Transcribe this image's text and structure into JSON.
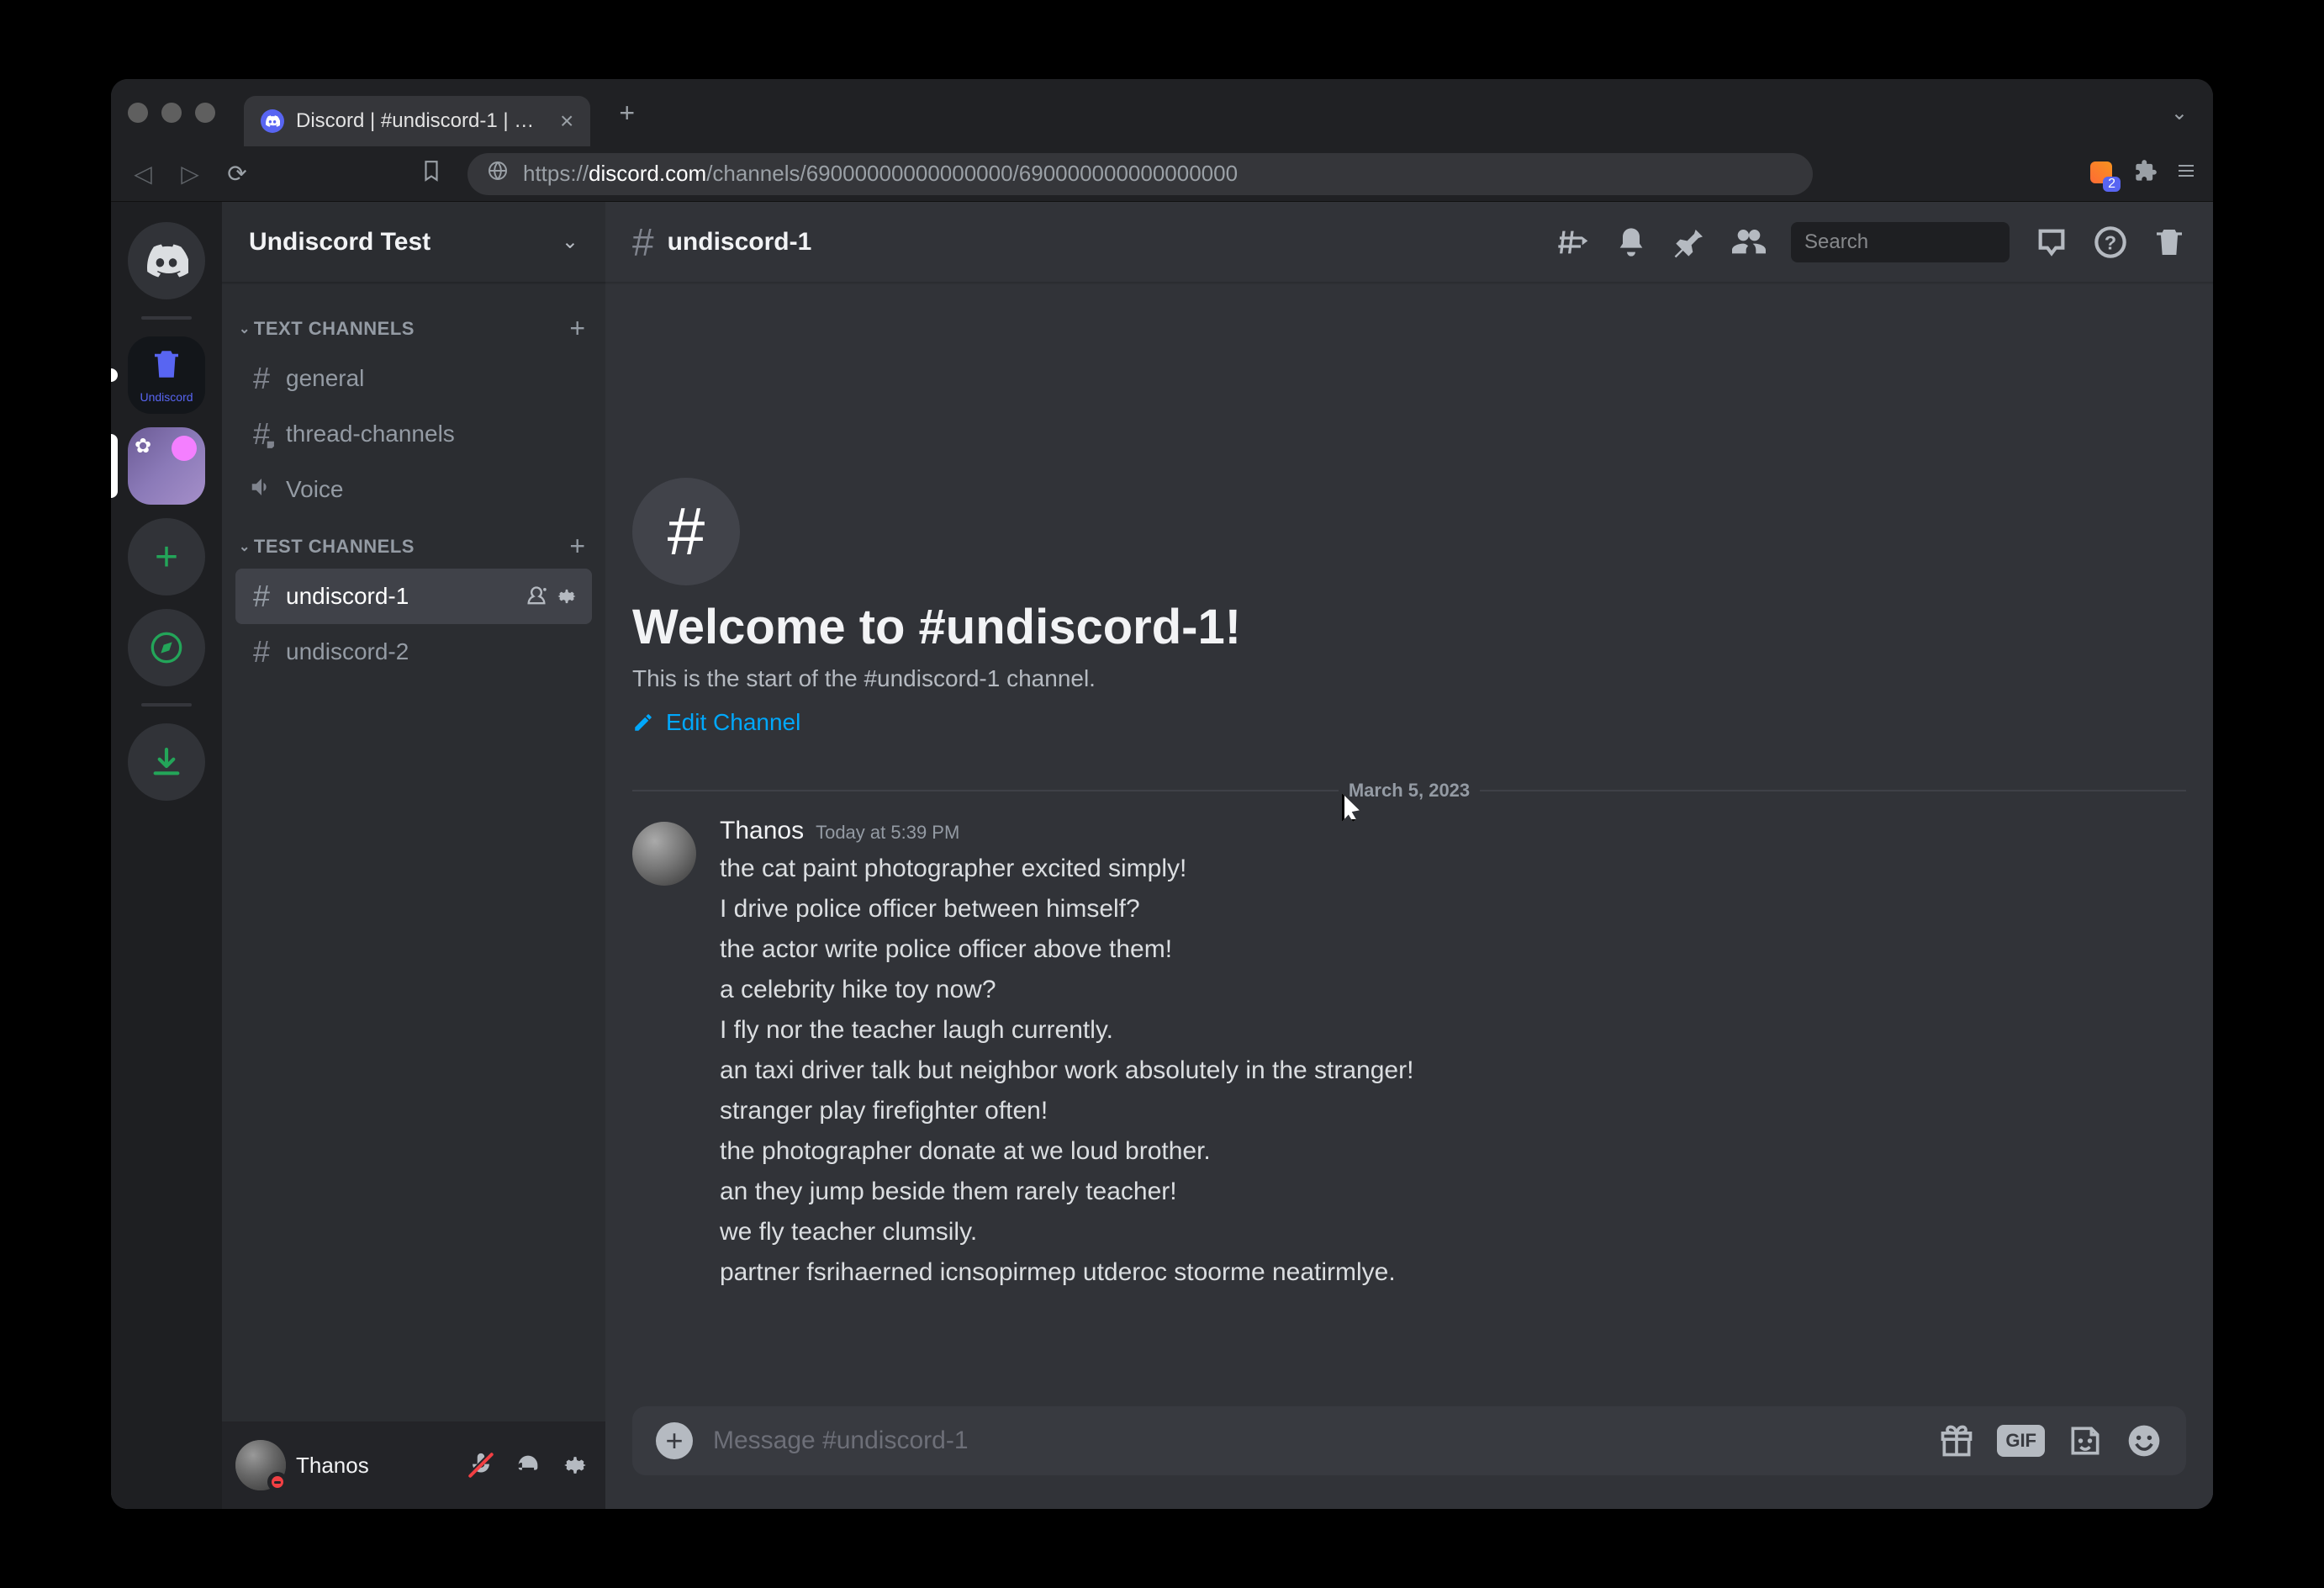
{
  "browser": {
    "tab_title": "Discord | #undiscord-1 | Undisc",
    "url_prefix": "https://",
    "url_host": "discord.com",
    "url_path": "/channels/69000000000000000/690000000000000000",
    "ext_badge": "2"
  },
  "server": {
    "name": "Undiscord Test"
  },
  "categories": [
    {
      "label": "TEXT CHANNELS",
      "channels": [
        {
          "name": "general",
          "type": "text",
          "active": false
        },
        {
          "name": "thread-channels",
          "type": "thread",
          "active": false
        },
        {
          "name": "Voice",
          "type": "voice",
          "active": false
        }
      ]
    },
    {
      "label": "TEST CHANNELS",
      "channels": [
        {
          "name": "undiscord-1",
          "type": "text",
          "active": true
        },
        {
          "name": "undiscord-2",
          "type": "text",
          "active": false
        }
      ]
    }
  ],
  "user": {
    "name": "Thanos"
  },
  "chat": {
    "channel_name": "undiscord-1",
    "search_placeholder": "Search",
    "welcome_title": "Welcome to #undiscord-1!",
    "welcome_sub": "This is the start of the #undiscord-1 channel.",
    "edit_channel": "Edit Channel",
    "date_divider": "March 5, 2023",
    "composer_placeholder": "Message #undiscord-1",
    "gif_label": "GIF"
  },
  "message": {
    "author": "Thanos",
    "timestamp": "Today at 5:39 PM",
    "lines": [
      "the cat paint photographer excited simply!",
      "I drive police officer between himself?",
      "the actor write police officer above them!",
      "a celebrity hike toy now?",
      "I fly nor the teacher laugh currently.",
      "an taxi driver talk but neighbor work absolutely in the stranger!",
      "stranger play firefighter often!",
      "the photographer donate at we loud brother.",
      "an they jump beside them rarely teacher!",
      "we fly teacher clumsily.",
      "partner fsrihaerned  icnsopirmep utderoc stoorme neatirmlye."
    ]
  }
}
